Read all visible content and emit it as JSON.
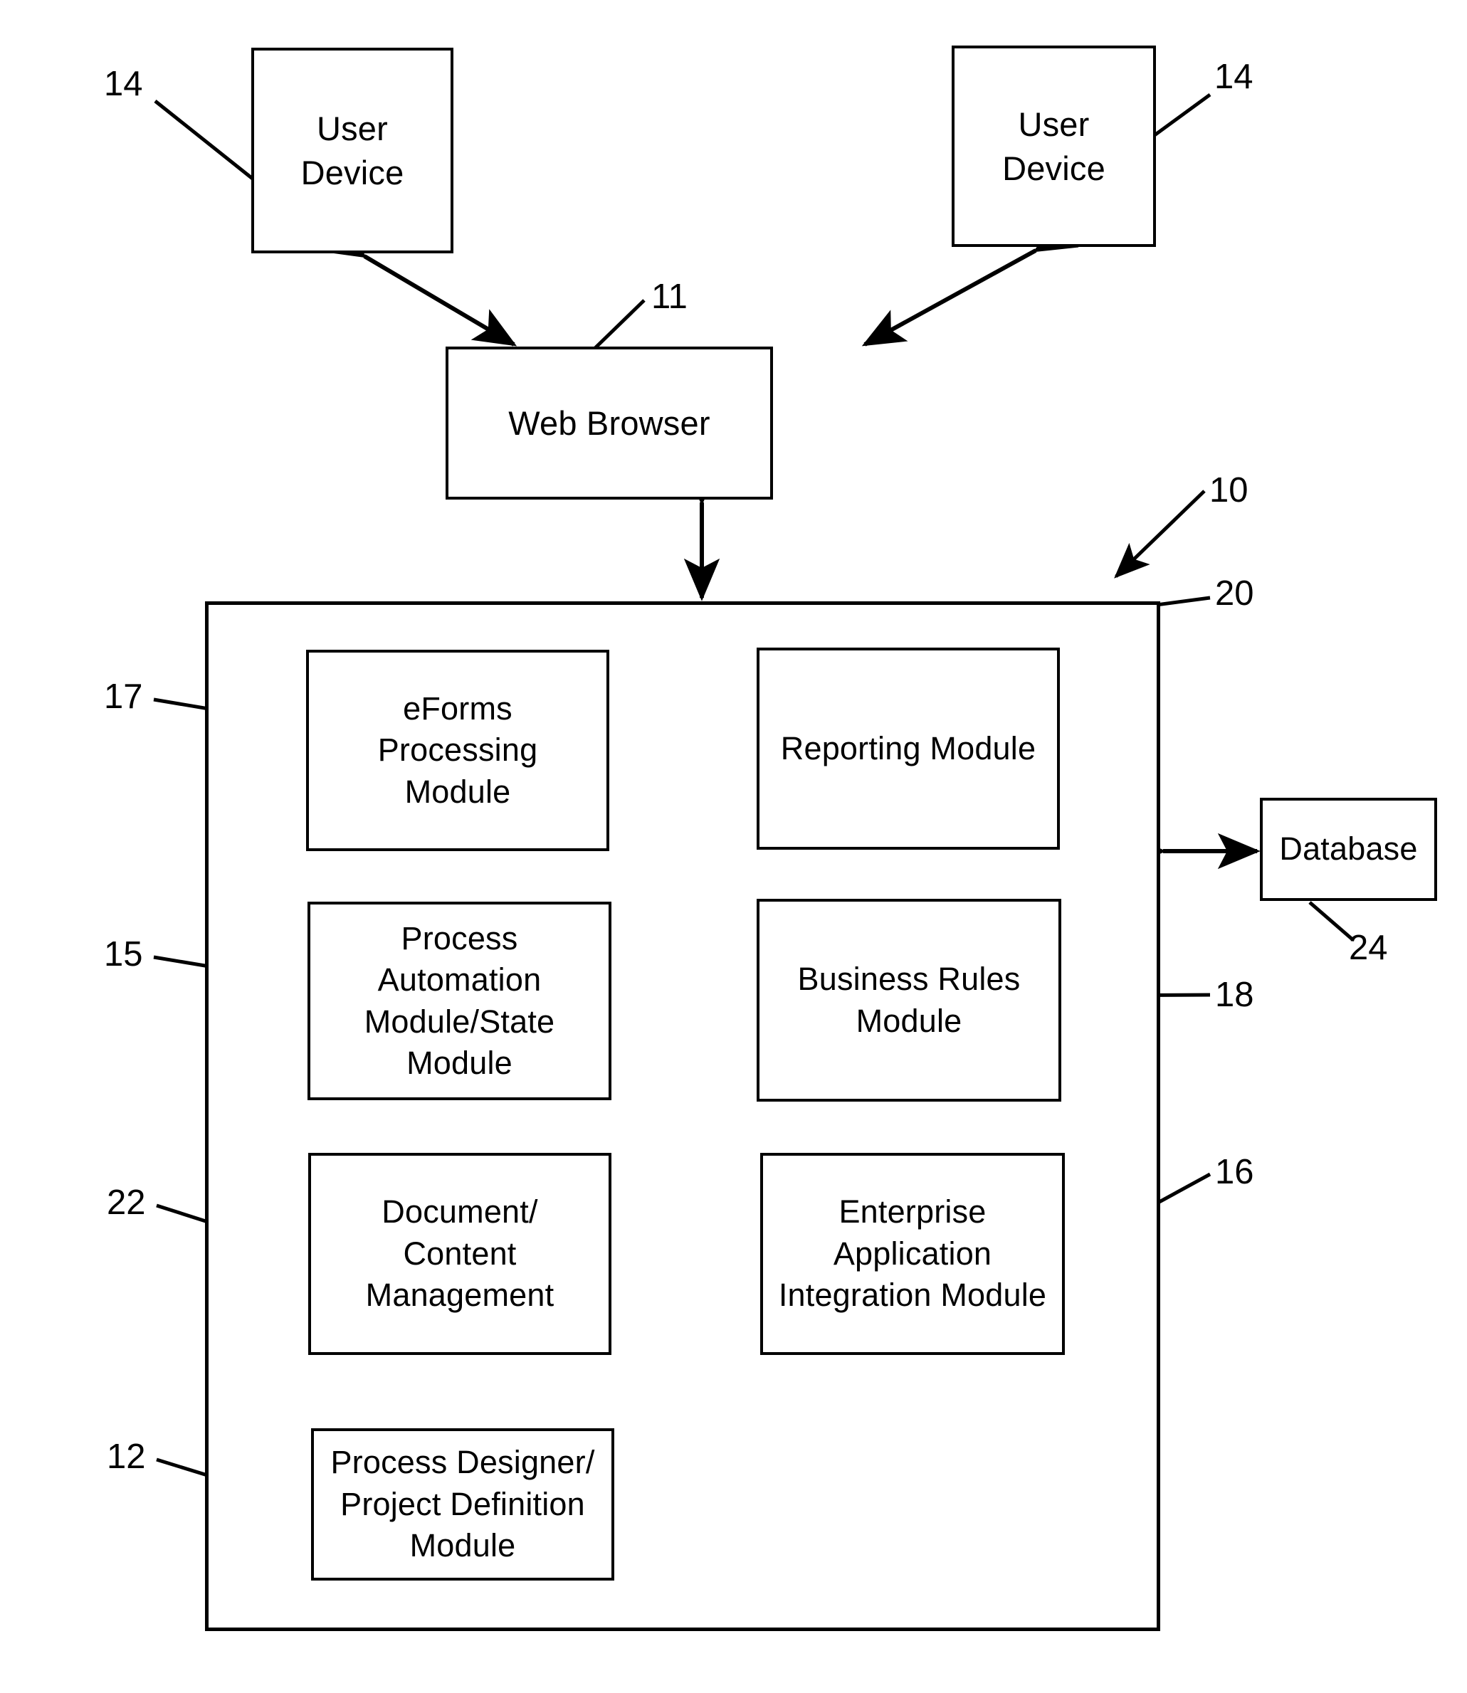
{
  "figure": {
    "title": "System architecture block diagram",
    "line_color": "#000000",
    "background": "#ffffff"
  },
  "nodes": {
    "user_device_left": "User\nDevice",
    "user_device_right": "User\nDevice",
    "web_browser": "Web Browser",
    "eforms_module": "eForms\nProcessing\nModule",
    "reporting_module": "Reporting Module",
    "process_automation_module": "Process\nAutomation\nModule/State\nModule",
    "business_rules_module": "Business Rules\nModule",
    "document_content_module": "Document/\nContent\nManagement",
    "eai_module": "Enterprise\nApplication\nIntegration Module",
    "process_designer_module": "Process Designer/\nProject Definition\nModule",
    "database": "Database"
  },
  "reference_numerals": {
    "user_device_left": "14",
    "user_device_right": "14",
    "web_browser": "11",
    "system": "10",
    "eforms_module": "17",
    "reporting_module": "20",
    "process_automation_module": "15",
    "business_rules_module": "18",
    "document_content_module": "22",
    "eai_module": "16",
    "process_designer_module": "12",
    "database": "24"
  }
}
